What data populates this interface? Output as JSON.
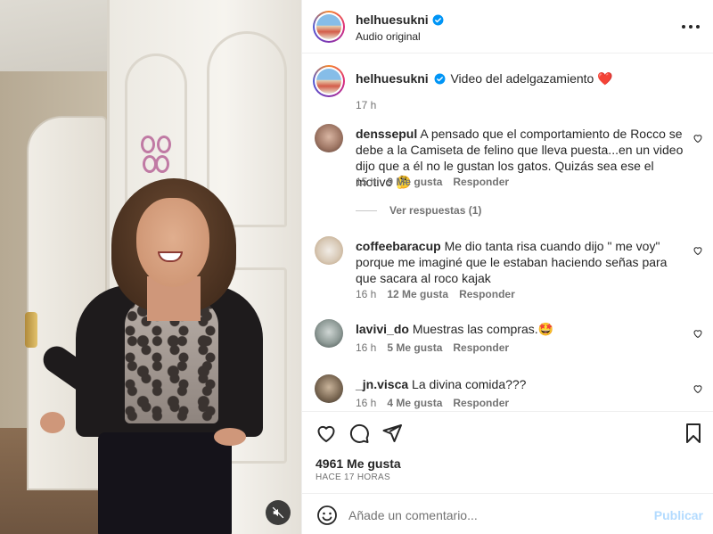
{
  "post": {
    "author": "helhuesukni",
    "audio": "Audio original",
    "caption_text": "Video del adelgazamiento",
    "caption_emoji": "❤️",
    "caption_time": "17 h"
  },
  "comments": [
    {
      "user": "denssepul",
      "text": "A pensado que el comportamiento de Rocco se debe a la Camiseta de felino que lleva puesta...en un video dijo que a él no le gustan los gatos. Quizás sea ese el motivo 🤔",
      "time": "15 h",
      "likes": "9 Me gusta",
      "reply": "Responder",
      "view_replies": "Ver respuestas (1)"
    },
    {
      "user": "coffeebaracup",
      "text": "Me dio tanta risa cuando dijo \" me voy\" porque me imaginé que le estaban haciendo señas para que sacara al roco kajak",
      "time": "16 h",
      "likes": "12 Me gusta",
      "reply": "Responder"
    },
    {
      "user": "lavivi_do",
      "text": "Muestras las compras.🤩",
      "time": "16 h",
      "likes": "5 Me gusta",
      "reply": "Responder"
    },
    {
      "user": "_jn.visca",
      "text": "La divina comida???",
      "time": "16 h",
      "likes": "4 Me gusta",
      "reply": "Responder"
    }
  ],
  "stats": {
    "likes": "4961 Me gusta",
    "posted": "HACE 17 HORAS"
  },
  "composer": {
    "placeholder": "Añade un comentario...",
    "publish": "Publicar"
  },
  "icons": {
    "more": "more-options-icon",
    "like": "heart-icon",
    "comment": "comment-icon",
    "share": "share-icon",
    "save": "bookmark-icon",
    "emoji": "emoji-icon",
    "mute": "muted-speaker-icon",
    "verified": "verified-badge-icon"
  },
  "colors": {
    "verified": "#0095f6",
    "publish_disabled": "#b3dbff",
    "secondary_text": "#737373"
  }
}
